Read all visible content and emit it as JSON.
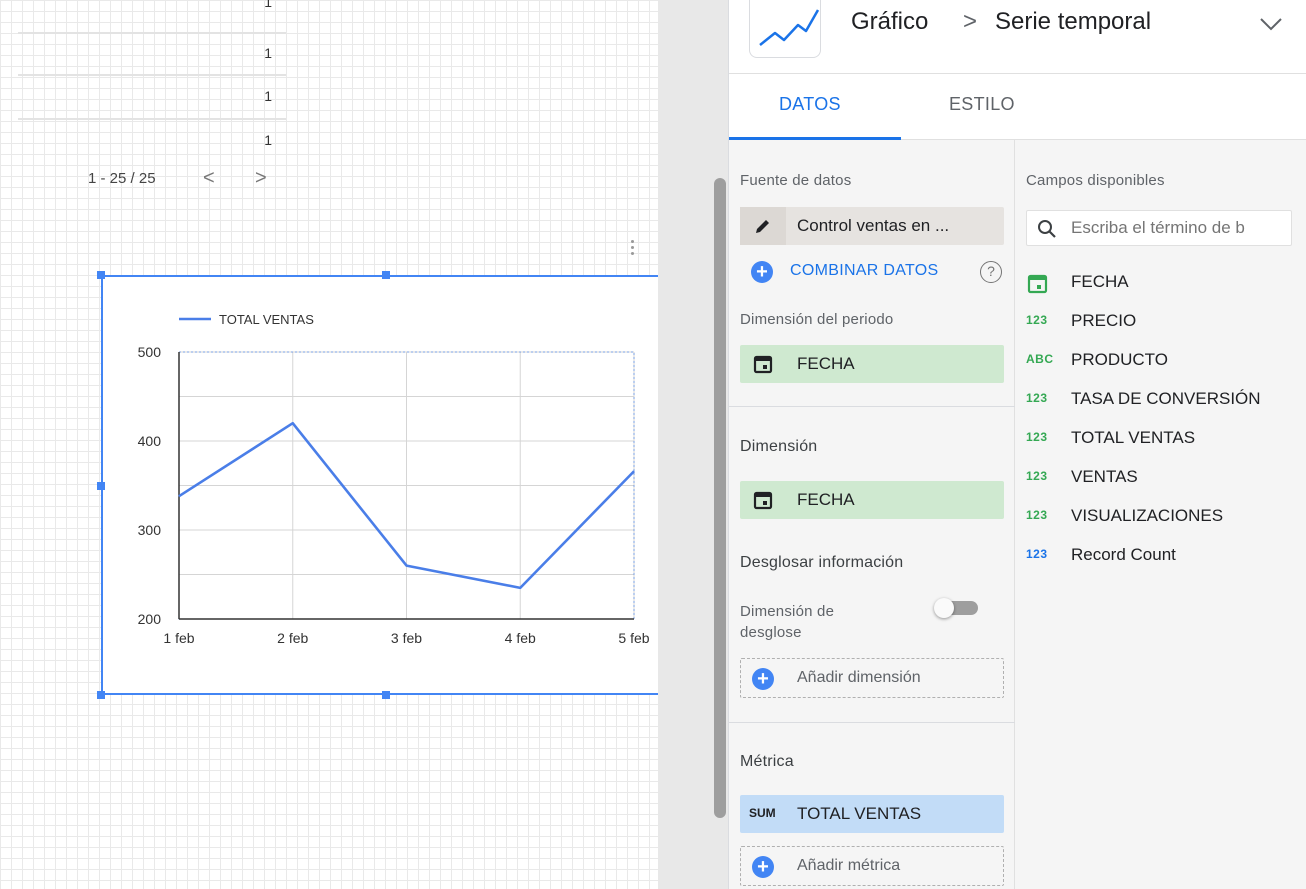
{
  "canvas": {
    "table": {
      "values": [
        "1",
        "1",
        "1",
        "1"
      ],
      "pager": "1 - 25 / 25",
      "prev_symbol": "<",
      "next_symbol": ">"
    }
  },
  "chart_data": {
    "type": "line",
    "categories": [
      "1 feb",
      "2 feb",
      "3 feb",
      "4 feb",
      "5 feb"
    ],
    "series": [
      {
        "name": "TOTAL VENTAS",
        "values": [
          338,
          420,
          260,
          235,
          366
        ],
        "color": "#4a7ee8"
      }
    ],
    "ylim": [
      200,
      500
    ],
    "yticks": [
      "200",
      "300",
      "400",
      "500"
    ],
    "legend_position": "top-left",
    "grid": true
  },
  "panel": {
    "title": "Gráfico",
    "breadcrumb_separator": ">",
    "subtitle": "Serie temporal",
    "tabs": [
      {
        "label": "DATOS",
        "active": true
      },
      {
        "label": "ESTILO",
        "active": false
      }
    ],
    "data_source": {
      "label": "Fuente de datos",
      "value": "Control ventas en ...",
      "blend_label": "COMBINAR DATOS",
      "help_symbol": "?"
    },
    "period_dimension": {
      "label": "Dimensión del periodo",
      "value": "FECHA"
    },
    "dimension": {
      "label": "Dimensión",
      "value": "FECHA"
    },
    "drilldown": {
      "label": "Desglosar información",
      "toggle_label_line1": "Dimensión de",
      "toggle_label_line2": "desglose",
      "enabled": false,
      "add_label": "Añadir dimensión"
    },
    "metric": {
      "label": "Métrica",
      "aggregation": "SUM",
      "value": "TOTAL VENTAS",
      "add_label": "Añadir métrica"
    },
    "available_fields": {
      "label": "Campos disponibles",
      "search_placeholder": "Escriba el término de b",
      "fields": [
        {
          "type": "date",
          "type_label": "",
          "name": "FECHA"
        },
        {
          "type": "number",
          "type_label": "123",
          "name": "PRECIO"
        },
        {
          "type": "text",
          "type_label": "ABC",
          "name": "PRODUCTO"
        },
        {
          "type": "number",
          "type_label": "123",
          "name": "TASA DE CONVERSIÓN"
        },
        {
          "type": "number",
          "type_label": "123",
          "name": "TOTAL VENTAS"
        },
        {
          "type": "number",
          "type_label": "123",
          "name": "VENTAS"
        },
        {
          "type": "number",
          "type_label": "123",
          "name": "VISUALIZACIONES"
        },
        {
          "type": "number-blue",
          "type_label": "123",
          "name": "Record Count"
        }
      ]
    }
  },
  "colors": {
    "accent": "#1a73e8",
    "selection": "#4285f4",
    "dimension_chip": "#cfe9d0",
    "metric_chip": "#c2dcf7"
  }
}
